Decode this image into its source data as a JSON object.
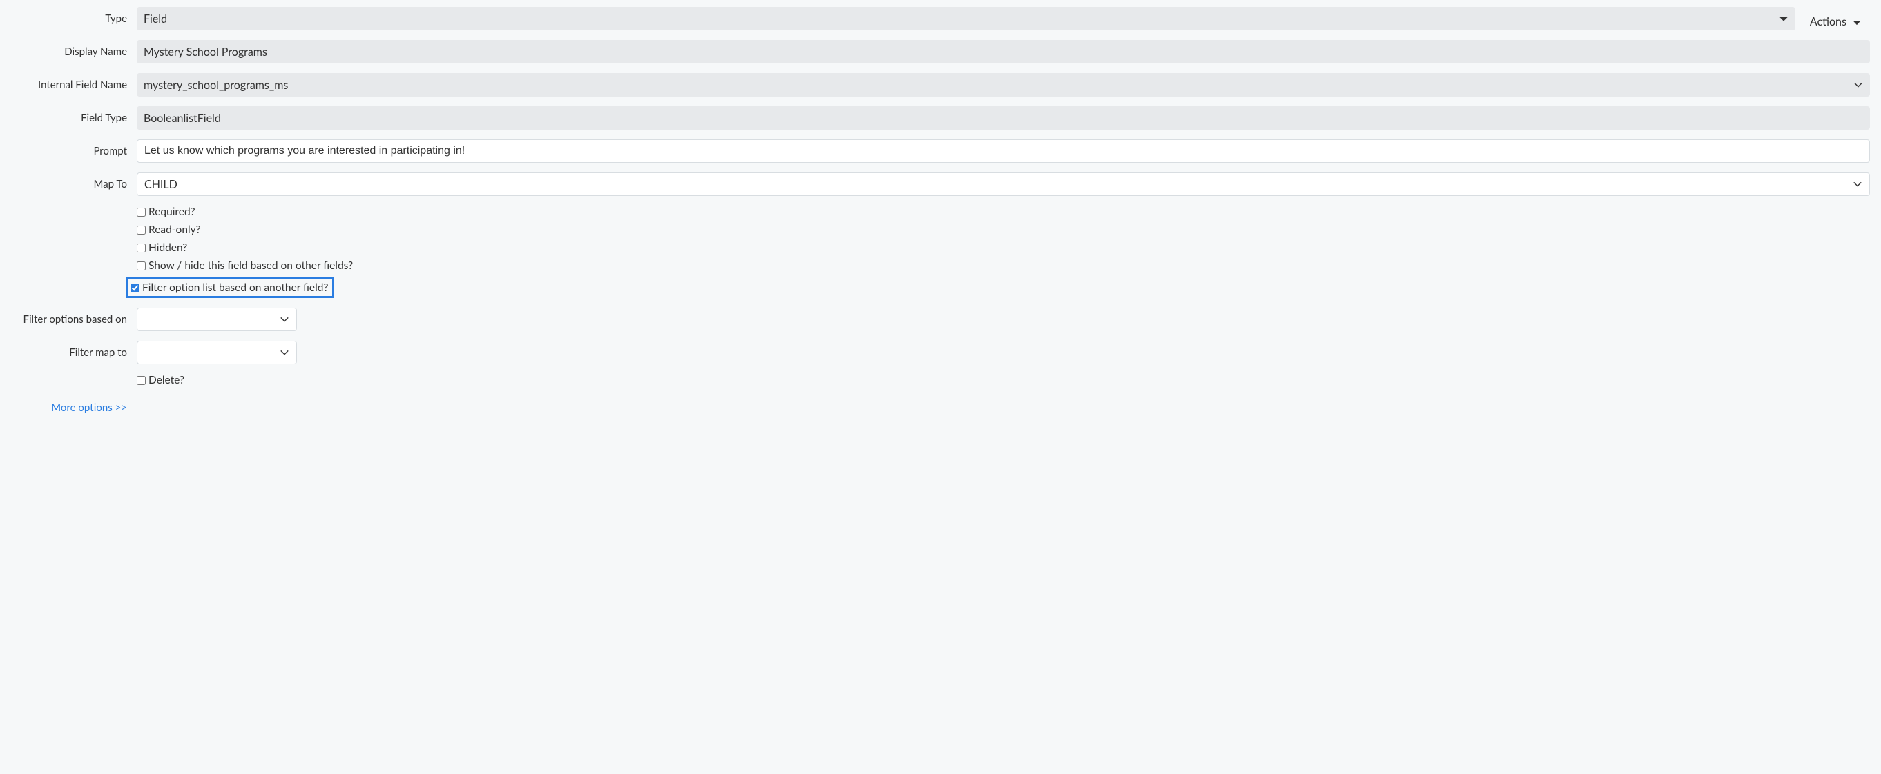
{
  "actions_label": "Actions",
  "labels": {
    "type": "Type",
    "display_name": "Display Name",
    "internal_field_name": "Internal Field Name",
    "field_type": "Field Type",
    "prompt": "Prompt",
    "map_to": "Map To",
    "filter_options_based_on": "Filter options based on",
    "filter_map_to": "Filter map to"
  },
  "values": {
    "type": "Field",
    "display_name": "Mystery School Programs",
    "internal_field_name": "mystery_school_programs_ms",
    "field_type": "BooleanlistField",
    "prompt": "Let us know which programs you are interested in participating in!",
    "map_to": "CHILD",
    "filter_options_based_on": "",
    "filter_map_to": ""
  },
  "checkboxes": {
    "required": "Required?",
    "read_only": "Read-only?",
    "hidden": "Hidden?",
    "show_hide": "Show / hide this field based on other fields?",
    "filter_option": "Filter option list based on another field?",
    "delete": "Delete?"
  },
  "more_options": "More options >>"
}
